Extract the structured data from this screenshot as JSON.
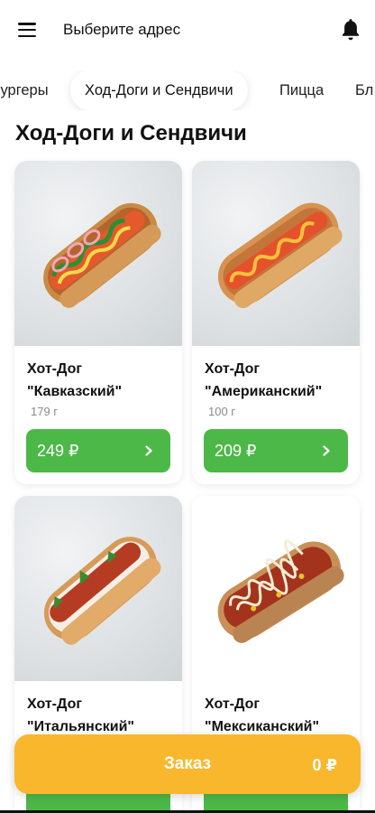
{
  "header": {
    "address_label": "Выберите адрес"
  },
  "tabs": [
    {
      "label": "Бургеры"
    },
    {
      "label": "Ход-Доги и Сендвичи",
      "active": true
    },
    {
      "label": "Пицца"
    },
    {
      "label": "Бл"
    }
  ],
  "section": {
    "title": "Ход-Доги и Сендвичи"
  },
  "products": [
    {
      "name_line1": "Хот-Дог",
      "name_line2": "\"Кавказский\"",
      "weight": "179 г",
      "price": "249 ₽"
    },
    {
      "name_line1": "Хот-Дог",
      "name_line2": "\"Американский\"",
      "weight": "100 г",
      "price": "209 ₽"
    },
    {
      "name_line1": "Хот-Дог",
      "name_line2": "\"Итальянский\"",
      "weight": "",
      "price": ""
    },
    {
      "name_line1": "Хот-Дог",
      "name_line2": "\"Мексиканский\"",
      "weight": "",
      "price": ""
    }
  ],
  "order": {
    "label": "Заказ",
    "total": "0 ₽"
  },
  "colors": {
    "accent_green": "#4cb848",
    "order_yellow": "#f8b72c"
  },
  "icons": {
    "menu": "menu-icon",
    "bell": "bell-icon",
    "chevron": "chevron-right-icon"
  }
}
